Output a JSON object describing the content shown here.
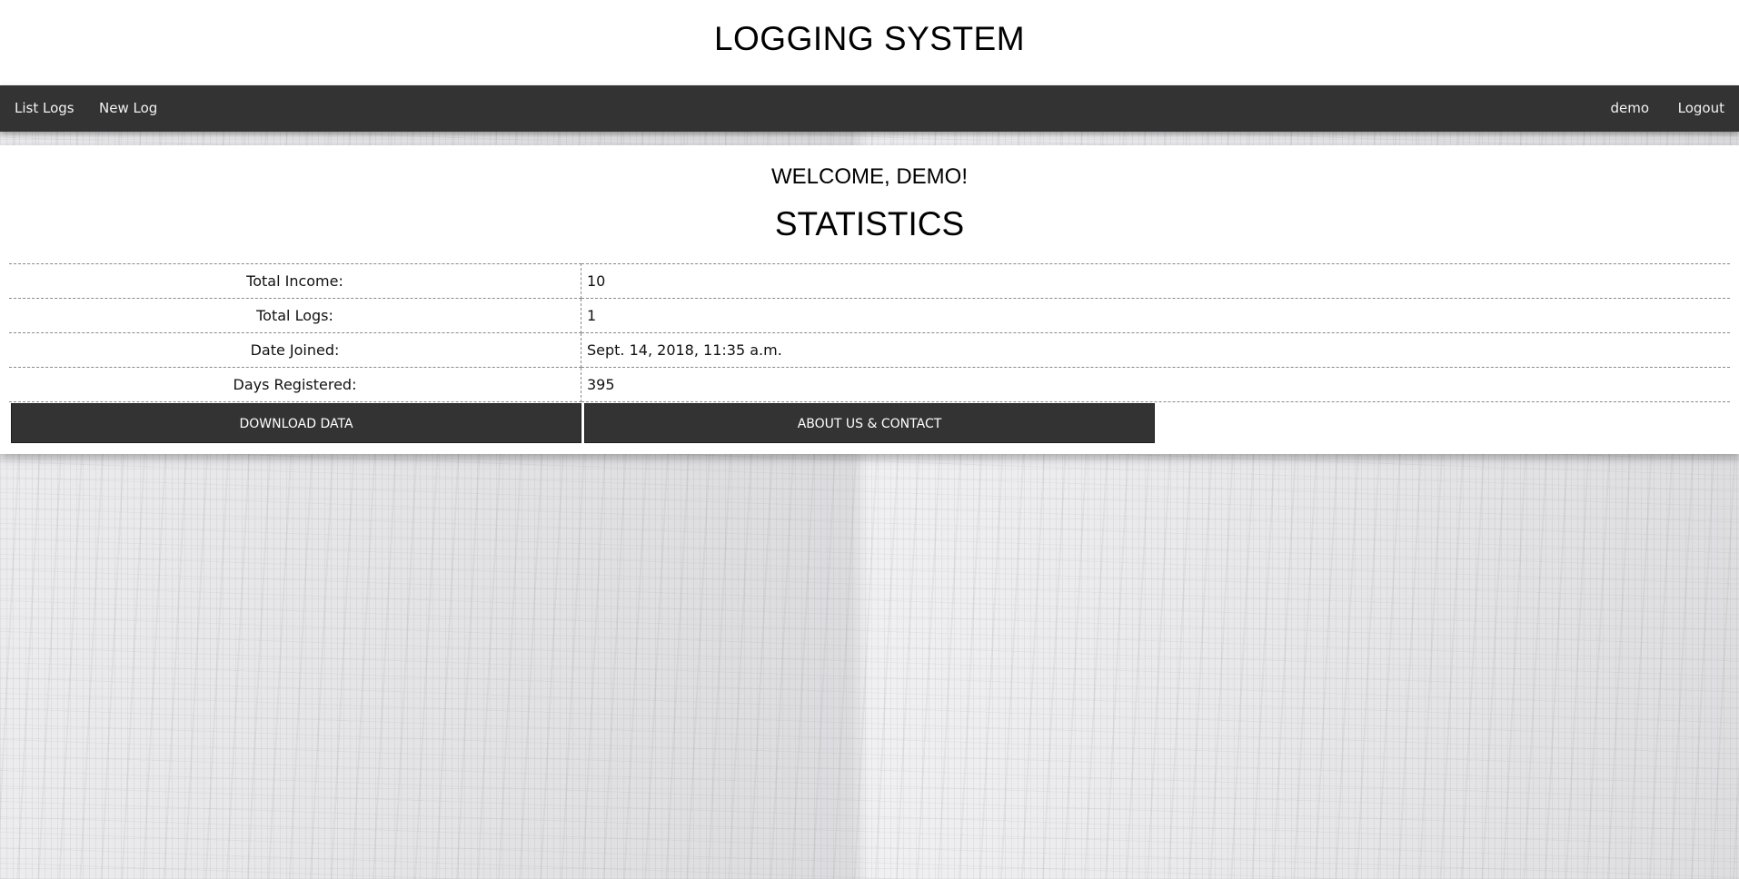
{
  "header": {
    "title": "LOGGING SYSTEM"
  },
  "nav": {
    "left": [
      "List Logs",
      "New Log"
    ],
    "user": "demo",
    "logout": "Logout"
  },
  "main": {
    "welcome": "WELCOME, DEMO!",
    "stats_title": "STATISTICS",
    "stats": [
      {
        "label": "Total Income:",
        "value": "10"
      },
      {
        "label": "Total Logs:",
        "value": "1"
      },
      {
        "label": "Date Joined:",
        "value": "Sept. 14, 2018, 11:35 a.m."
      },
      {
        "label": "Days Registered:",
        "value": "395"
      }
    ],
    "buttons": {
      "download": "DOWNLOAD DATA",
      "about": "ABOUT US & CONTACT"
    }
  },
  "colors": {
    "navbar": "#333333",
    "button": "#333333"
  }
}
